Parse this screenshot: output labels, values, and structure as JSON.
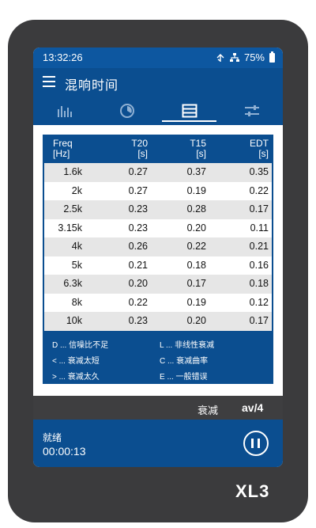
{
  "status": {
    "time": "13:32:26",
    "battery": "75%"
  },
  "header": {
    "title": "混响时间"
  },
  "tabs": [
    {
      "icon": "bar-graph-icon"
    },
    {
      "icon": "decay-clock-icon"
    },
    {
      "icon": "table-icon",
      "active": true
    },
    {
      "icon": "settings-sliders-icon"
    }
  ],
  "table": {
    "columns": [
      {
        "name": "Freq",
        "unit": "[Hz]"
      },
      {
        "name": "T20",
        "unit": "[s]"
      },
      {
        "name": "T15",
        "unit": "[s]"
      },
      {
        "name": "EDT",
        "unit": "[s]"
      }
    ],
    "rows": [
      [
        "1.6k",
        "0.27",
        "0.37",
        "0.35"
      ],
      [
        "2k",
        "0.27",
        "0.19",
        "0.22"
      ],
      [
        "2.5k",
        "0.23",
        "0.28",
        "0.17"
      ],
      [
        "3.15k",
        "0.23",
        "0.20",
        "0.11"
      ],
      [
        "4k",
        "0.26",
        "0.22",
        "0.21"
      ],
      [
        "5k",
        "0.21",
        "0.18",
        "0.16"
      ],
      [
        "6.3k",
        "0.20",
        "0.17",
        "0.18"
      ],
      [
        "8k",
        "0.22",
        "0.19",
        "0.12"
      ],
      [
        "10k",
        "0.23",
        "0.20",
        "0.17"
      ]
    ]
  },
  "legend": [
    "D ... 信噪比不足",
    "L ... 非线性衰减",
    "< ... 衰减太短",
    "C ... 衰减曲率",
    "> ... 衰减太久",
    "E ... 一般错误"
  ],
  "decay": {
    "label": "衰减",
    "value": "av/4"
  },
  "footer": {
    "status": "就绪",
    "elapsed": "00:00:13"
  },
  "brand": "XL3",
  "colors": {
    "primary": "#0b4e90",
    "statusbar": "#0d57a0",
    "device": "#3b3b3d",
    "row_alt": "#e6e6e6"
  }
}
